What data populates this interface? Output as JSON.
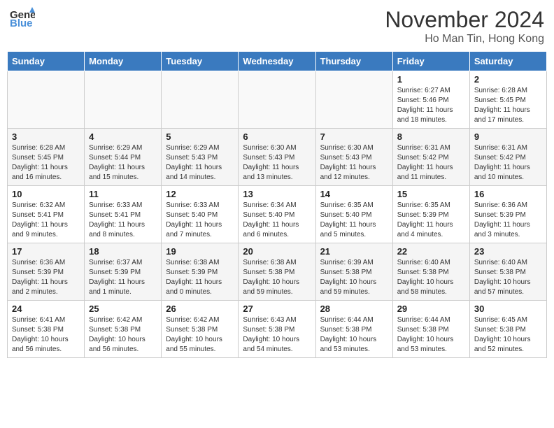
{
  "header": {
    "logo_general": "General",
    "logo_blue": "Blue",
    "month_title": "November 2024",
    "location": "Ho Man Tin, Hong Kong"
  },
  "days_of_week": [
    "Sunday",
    "Monday",
    "Tuesday",
    "Wednesday",
    "Thursday",
    "Friday",
    "Saturday"
  ],
  "weeks": [
    [
      {
        "day": "",
        "info": "",
        "empty": true
      },
      {
        "day": "",
        "info": "",
        "empty": true
      },
      {
        "day": "",
        "info": "",
        "empty": true
      },
      {
        "day": "",
        "info": "",
        "empty": true
      },
      {
        "day": "",
        "info": "",
        "empty": true
      },
      {
        "day": "1",
        "info": "Sunrise: 6:27 AM\nSunset: 5:46 PM\nDaylight: 11 hours and 18 minutes."
      },
      {
        "day": "2",
        "info": "Sunrise: 6:28 AM\nSunset: 5:45 PM\nDaylight: 11 hours and 17 minutes."
      }
    ],
    [
      {
        "day": "3",
        "info": "Sunrise: 6:28 AM\nSunset: 5:45 PM\nDaylight: 11 hours and 16 minutes."
      },
      {
        "day": "4",
        "info": "Sunrise: 6:29 AM\nSunset: 5:44 PM\nDaylight: 11 hours and 15 minutes."
      },
      {
        "day": "5",
        "info": "Sunrise: 6:29 AM\nSunset: 5:43 PM\nDaylight: 11 hours and 14 minutes."
      },
      {
        "day": "6",
        "info": "Sunrise: 6:30 AM\nSunset: 5:43 PM\nDaylight: 11 hours and 13 minutes."
      },
      {
        "day": "7",
        "info": "Sunrise: 6:30 AM\nSunset: 5:43 PM\nDaylight: 11 hours and 12 minutes."
      },
      {
        "day": "8",
        "info": "Sunrise: 6:31 AM\nSunset: 5:42 PM\nDaylight: 11 hours and 11 minutes."
      },
      {
        "day": "9",
        "info": "Sunrise: 6:31 AM\nSunset: 5:42 PM\nDaylight: 11 hours and 10 minutes."
      }
    ],
    [
      {
        "day": "10",
        "info": "Sunrise: 6:32 AM\nSunset: 5:41 PM\nDaylight: 11 hours and 9 minutes."
      },
      {
        "day": "11",
        "info": "Sunrise: 6:33 AM\nSunset: 5:41 PM\nDaylight: 11 hours and 8 minutes."
      },
      {
        "day": "12",
        "info": "Sunrise: 6:33 AM\nSunset: 5:40 PM\nDaylight: 11 hours and 7 minutes."
      },
      {
        "day": "13",
        "info": "Sunrise: 6:34 AM\nSunset: 5:40 PM\nDaylight: 11 hours and 6 minutes."
      },
      {
        "day": "14",
        "info": "Sunrise: 6:35 AM\nSunset: 5:40 PM\nDaylight: 11 hours and 5 minutes."
      },
      {
        "day": "15",
        "info": "Sunrise: 6:35 AM\nSunset: 5:39 PM\nDaylight: 11 hours and 4 minutes."
      },
      {
        "day": "16",
        "info": "Sunrise: 6:36 AM\nSunset: 5:39 PM\nDaylight: 11 hours and 3 minutes."
      }
    ],
    [
      {
        "day": "17",
        "info": "Sunrise: 6:36 AM\nSunset: 5:39 PM\nDaylight: 11 hours and 2 minutes."
      },
      {
        "day": "18",
        "info": "Sunrise: 6:37 AM\nSunset: 5:39 PM\nDaylight: 11 hours and 1 minute."
      },
      {
        "day": "19",
        "info": "Sunrise: 6:38 AM\nSunset: 5:39 PM\nDaylight: 11 hours and 0 minutes."
      },
      {
        "day": "20",
        "info": "Sunrise: 6:38 AM\nSunset: 5:38 PM\nDaylight: 10 hours and 59 minutes."
      },
      {
        "day": "21",
        "info": "Sunrise: 6:39 AM\nSunset: 5:38 PM\nDaylight: 10 hours and 59 minutes."
      },
      {
        "day": "22",
        "info": "Sunrise: 6:40 AM\nSunset: 5:38 PM\nDaylight: 10 hours and 58 minutes."
      },
      {
        "day": "23",
        "info": "Sunrise: 6:40 AM\nSunset: 5:38 PM\nDaylight: 10 hours and 57 minutes."
      }
    ],
    [
      {
        "day": "24",
        "info": "Sunrise: 6:41 AM\nSunset: 5:38 PM\nDaylight: 10 hours and 56 minutes."
      },
      {
        "day": "25",
        "info": "Sunrise: 6:42 AM\nSunset: 5:38 PM\nDaylight: 10 hours and 56 minutes."
      },
      {
        "day": "26",
        "info": "Sunrise: 6:42 AM\nSunset: 5:38 PM\nDaylight: 10 hours and 55 minutes."
      },
      {
        "day": "27",
        "info": "Sunrise: 6:43 AM\nSunset: 5:38 PM\nDaylight: 10 hours and 54 minutes."
      },
      {
        "day": "28",
        "info": "Sunrise: 6:44 AM\nSunset: 5:38 PM\nDaylight: 10 hours and 53 minutes."
      },
      {
        "day": "29",
        "info": "Sunrise: 6:44 AM\nSunset: 5:38 PM\nDaylight: 10 hours and 53 minutes."
      },
      {
        "day": "30",
        "info": "Sunrise: 6:45 AM\nSunset: 5:38 PM\nDaylight: 10 hours and 52 minutes."
      }
    ]
  ]
}
